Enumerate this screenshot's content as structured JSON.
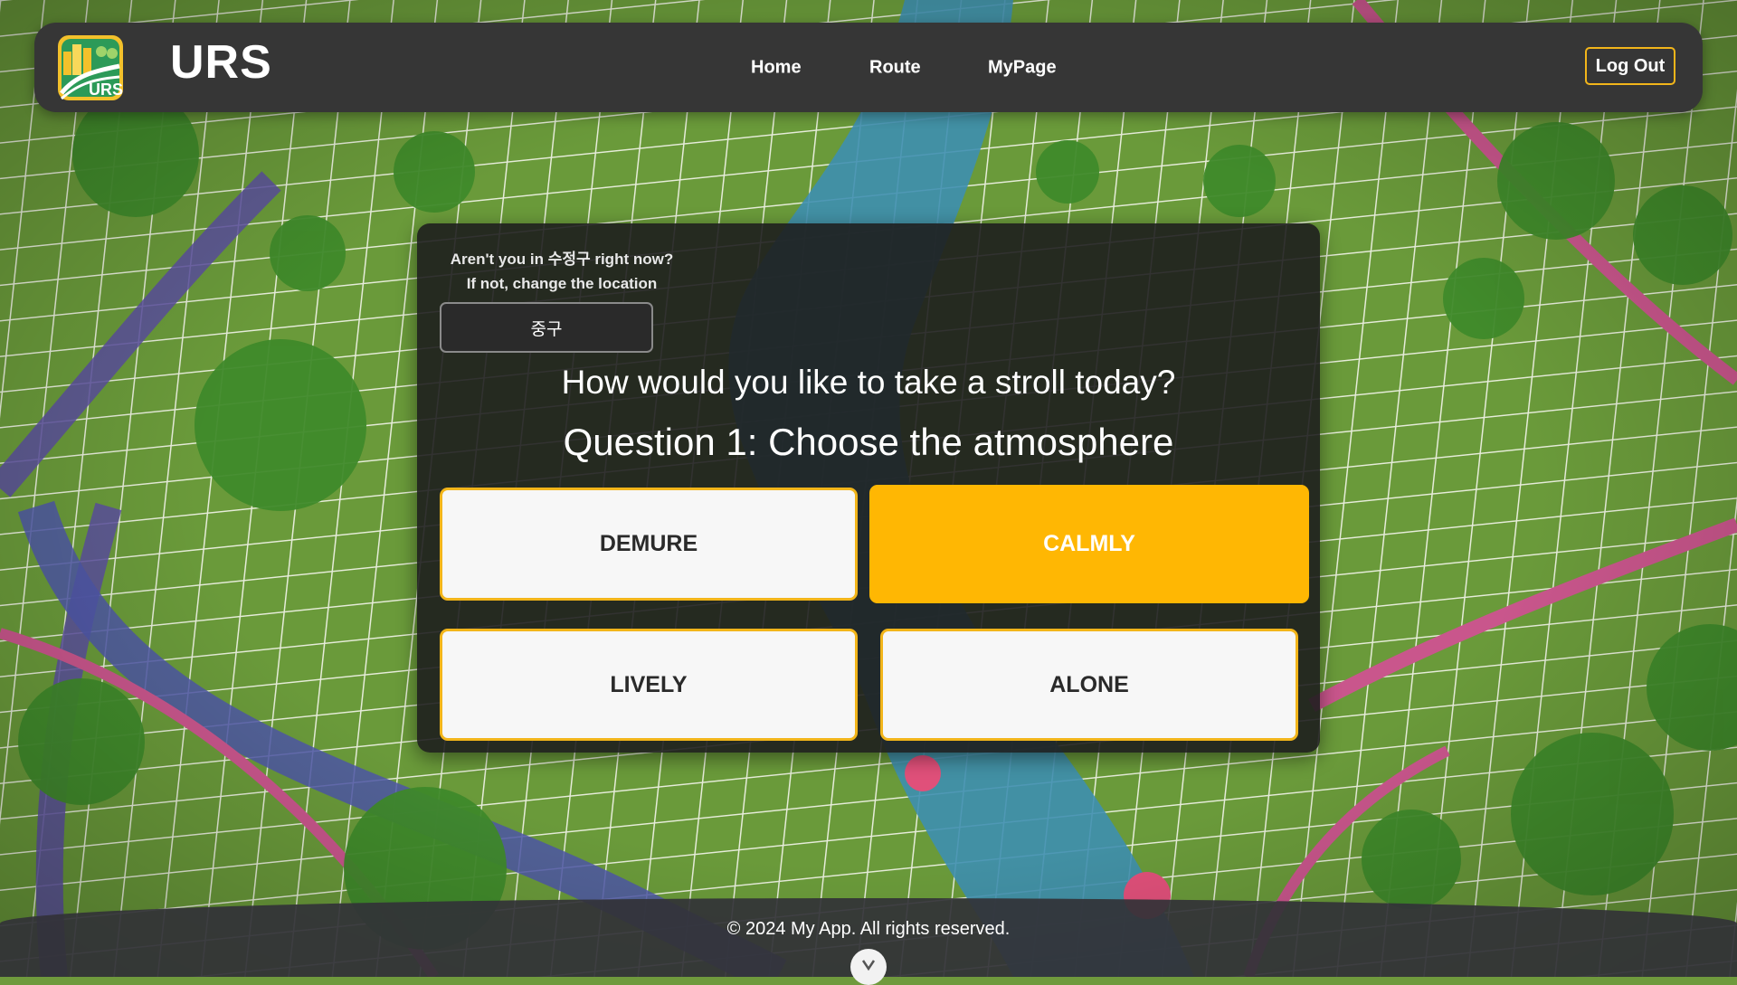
{
  "header": {
    "brand": "URS",
    "logo_text": "URS",
    "nav": [
      "Home",
      "Route",
      "MyPage"
    ],
    "logout_label": "Log Out"
  },
  "location": {
    "question_line1": "Aren't you in 수정구 right now?",
    "question_line2": "If not, change the location",
    "selected": "중구"
  },
  "survey": {
    "title": "How would you like to take a stroll today?",
    "question": "Question 1: Choose the atmosphere",
    "options": [
      {
        "label": "DEMURE",
        "selected": false
      },
      {
        "label": "CALMLY",
        "selected": true
      },
      {
        "label": "LIVELY",
        "selected": false
      },
      {
        "label": "ALONE",
        "selected": false
      }
    ]
  },
  "footer": {
    "copyright": "© 2024 My App. All rights reserved."
  },
  "colors": {
    "accent": "#ffb703",
    "header_bg": "#363636",
    "card_bg": "#1e1e1e",
    "option_bg": "#f7f7f7"
  },
  "icons": {
    "logo": "city-park-logo-icon",
    "scroll": "chevron-down-icon"
  }
}
